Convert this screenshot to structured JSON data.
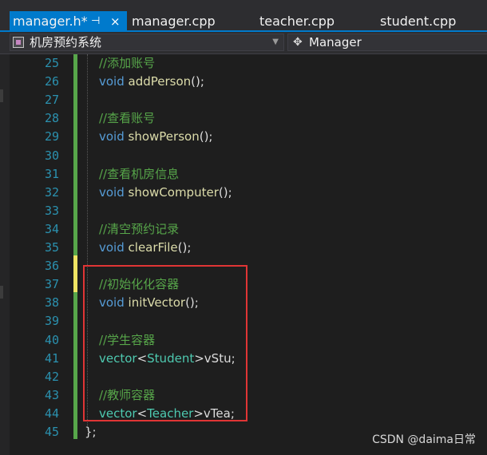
{
  "tabs": [
    {
      "label": "manager.h*",
      "active": true
    },
    {
      "label": "manager.cpp",
      "active": false
    },
    {
      "label": "teacher.cpp",
      "active": false
    },
    {
      "label": "student.cpp",
      "active": false
    }
  ],
  "tab_pin_glyph": "⊣",
  "tab_close_glyph": "×",
  "nav": {
    "project": "机房预约系统",
    "scope": "Manager"
  },
  "editor": {
    "lines": [
      {
        "num": "25",
        "kind": "comment",
        "text": "//添加账号"
      },
      {
        "num": "26",
        "kind": "decl",
        "type": "void",
        "name": "addPerson",
        "rest": "();"
      },
      {
        "num": "27",
        "kind": "blank"
      },
      {
        "num": "28",
        "kind": "comment",
        "text": "//查看账号"
      },
      {
        "num": "29",
        "kind": "decl",
        "type": "void",
        "name": "showPerson",
        "rest": "();"
      },
      {
        "num": "30",
        "kind": "blank"
      },
      {
        "num": "31",
        "kind": "comment",
        "text": "//查看机房信息"
      },
      {
        "num": "32",
        "kind": "decl",
        "type": "void",
        "name": "showComputer",
        "rest": "();"
      },
      {
        "num": "33",
        "kind": "blank"
      },
      {
        "num": "34",
        "kind": "comment",
        "text": "//清空预约记录"
      },
      {
        "num": "35",
        "kind": "decl",
        "type": "void",
        "name": "clearFile",
        "rest": "();"
      },
      {
        "num": "36",
        "kind": "blank"
      },
      {
        "num": "37",
        "kind": "comment",
        "text": "//初始化化容器"
      },
      {
        "num": "38",
        "kind": "decl",
        "type": "void",
        "name": "initVector",
        "rest": "();"
      },
      {
        "num": "39",
        "kind": "blank"
      },
      {
        "num": "40",
        "kind": "comment",
        "text": "//学生容器"
      },
      {
        "num": "41",
        "kind": "vector",
        "tmpl": "vector",
        "arg": "Student",
        "name": "vStu"
      },
      {
        "num": "42",
        "kind": "blank"
      },
      {
        "num": "43",
        "kind": "comment",
        "text": "//教师容器"
      },
      {
        "num": "44",
        "kind": "vector",
        "tmpl": "vector",
        "arg": "Teacher",
        "name": "vTea"
      },
      {
        "num": "45",
        "kind": "close",
        "text": "};"
      }
    ]
  },
  "colors": {
    "accent": "#007acc",
    "comment": "#57a64a",
    "keyword": "#569cd6",
    "function": "#dcdcaa",
    "type": "#4ec9b0",
    "line_number": "#2b91af",
    "highlight_box": "#e03535"
  },
  "watermark": "CSDN @daima日常"
}
